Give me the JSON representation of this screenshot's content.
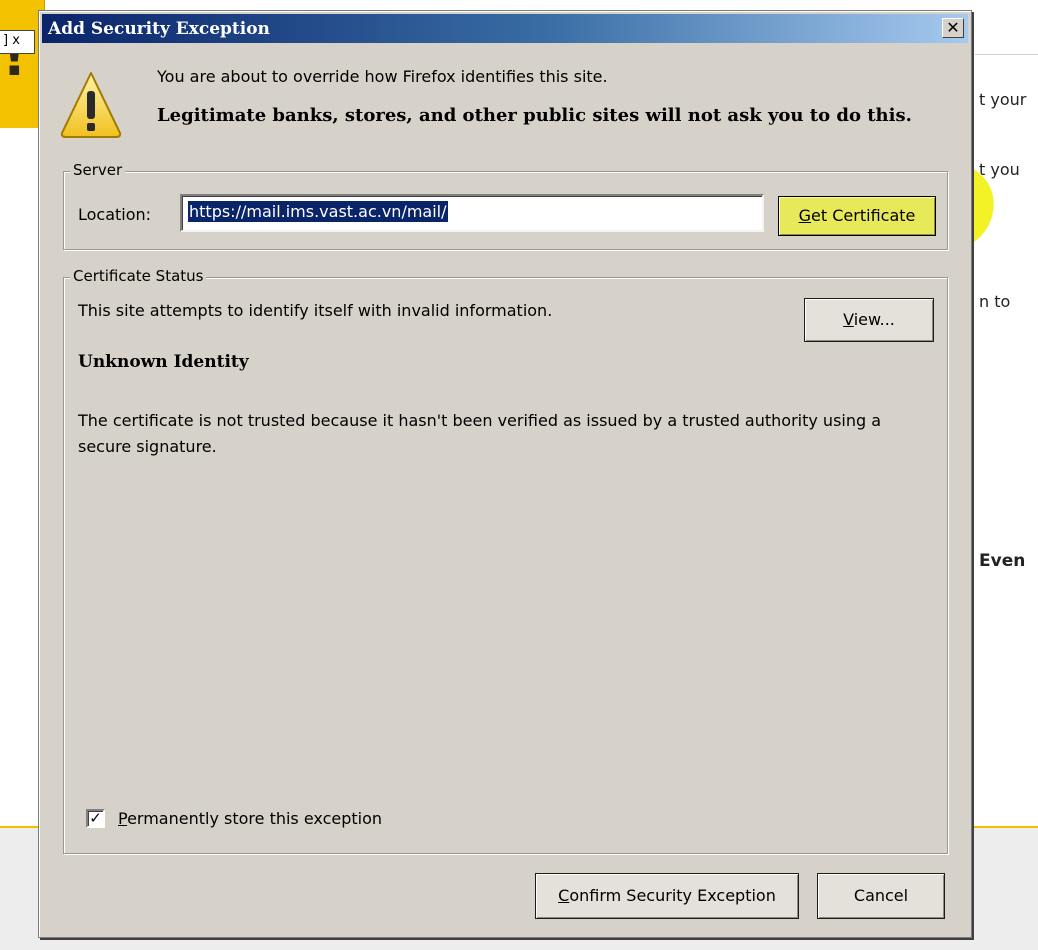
{
  "background": {
    "tab_label": "] x",
    "side_text": [
      "t your",
      "t you",
      "n to",
      "Even"
    ]
  },
  "dialog": {
    "title": "Add Security Exception",
    "close_glyph": "✕",
    "intro_line": "You are about to override how Firefox identifies this site.",
    "intro_warning": "Legitimate banks, stores, and other public sites will not ask you to do this.",
    "icons": {
      "warning": "warning-triangle-icon",
      "checkmark": "checkmark-icon"
    }
  },
  "server": {
    "legend": "Server",
    "location_label": "Location:",
    "location_value": "https://mail.ims.vast.ac.vn/mail/",
    "get_certificate_access": "G",
    "get_certificate_rest": "et Certificate"
  },
  "status": {
    "legend": "Certificate Status",
    "status_line": "This site attempts to identify itself with invalid information.",
    "view_access": "V",
    "view_rest": "iew...",
    "identity_heading": "Unknown Identity",
    "identity_description": "The certificate is not trusted because it hasn't been verified as issued by a trusted authority using a secure signature.",
    "permanent_checkbox_checked": true,
    "permanent_checkbox_glyph": "✓",
    "permanent_access": "P",
    "permanent_rest": "ermanently store this exception"
  },
  "buttons": {
    "confirm_access": "C",
    "confirm_rest": "onfirm Security Exception",
    "cancel": "Cancel"
  },
  "colors": {
    "titlebar_start": "#0a246a",
    "titlebar_end": "#a6caf0",
    "dialog_face": "#d6d2c9",
    "highlight": "#f3f227",
    "selection": "#0a246a",
    "warning_yellow": "#f2c200"
  }
}
